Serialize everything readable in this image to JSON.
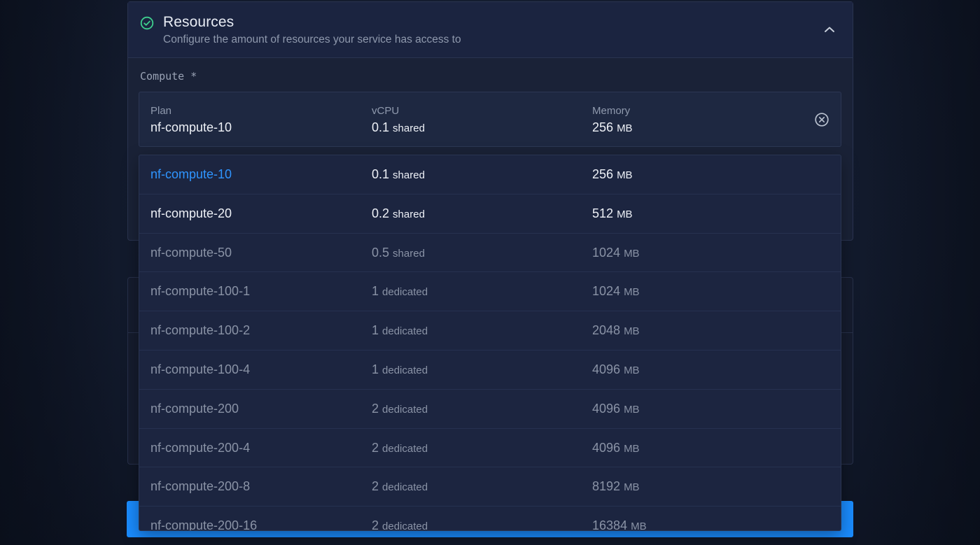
{
  "resources": {
    "title": "Resources",
    "subtitle": "Configure the amount of resources your service has access to",
    "compute_label": "Compute *"
  },
  "selected": {
    "plan_label": "Plan",
    "vcpu_label": "vCPU",
    "memory_label": "Memory",
    "plan": "nf-compute-10",
    "vcpu_value": "0.1",
    "vcpu_type": "shared",
    "memory_value": "256",
    "memory_unit": "MB"
  },
  "options": [
    {
      "plan": "nf-compute-10",
      "vcpu": "0.1",
      "type": "shared",
      "memory": "256",
      "unit": "MB"
    },
    {
      "plan": "nf-compute-20",
      "vcpu": "0.2",
      "type": "shared",
      "memory": "512",
      "unit": "MB"
    },
    {
      "plan": "nf-compute-50",
      "vcpu": "0.5",
      "type": "shared",
      "memory": "1024",
      "unit": "MB"
    },
    {
      "plan": "nf-compute-100-1",
      "vcpu": "1",
      "type": "dedicated",
      "memory": "1024",
      "unit": "MB"
    },
    {
      "plan": "nf-compute-100-2",
      "vcpu": "1",
      "type": "dedicated",
      "memory": "2048",
      "unit": "MB"
    },
    {
      "plan": "nf-compute-100-4",
      "vcpu": "1",
      "type": "dedicated",
      "memory": "4096",
      "unit": "MB"
    },
    {
      "plan": "nf-compute-200",
      "vcpu": "2",
      "type": "dedicated",
      "memory": "4096",
      "unit": "MB"
    },
    {
      "plan": "nf-compute-200-4",
      "vcpu": "2",
      "type": "dedicated",
      "memory": "4096",
      "unit": "MB"
    },
    {
      "plan": "nf-compute-200-8",
      "vcpu": "2",
      "type": "dedicated",
      "memory": "8192",
      "unit": "MB"
    },
    {
      "plan": "nf-compute-200-16",
      "vcpu": "2",
      "type": "dedicated",
      "memory": "16384",
      "unit": "MB"
    }
  ],
  "icons": {
    "status": "check-circle-icon",
    "collapse": "chevron-up-icon",
    "clear": "clear-circle-icon"
  },
  "colors": {
    "accent": "#1a8cff",
    "active_option": "#2f95ff",
    "success": "#3ecf8e"
  }
}
